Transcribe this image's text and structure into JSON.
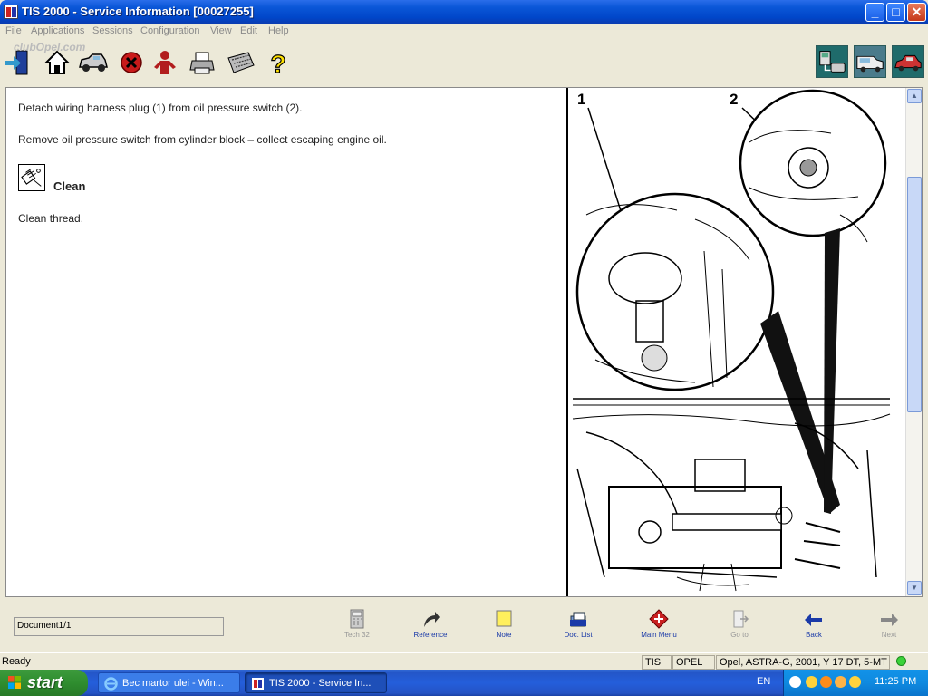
{
  "window": {
    "title": "TIS 2000 - Service Information [00027255]",
    "min_label": "_",
    "max_label": "□",
    "close_label": "✕"
  },
  "menu": {
    "items": [
      "File",
      "Applications",
      "Sessions",
      "Configuration",
      "View",
      "Edit",
      "Help"
    ]
  },
  "watermark": "clubOpel.com",
  "toolbar": {
    "icons": [
      "exit-icon",
      "home-icon",
      "vehicle-icon",
      "stop-icon",
      "user-icon",
      "print-icon",
      "keyboard-icon",
      "help-icon",
      "diagnostic-tool-icon",
      "van-icon",
      "car-icon"
    ]
  },
  "document": {
    "para1": "Detach wiring harness plug (1) from oil pressure switch (2).",
    "para2": "Remove oil pressure switch from cylinder block – collect escaping engine oil.",
    "clean_heading": "Clean",
    "para3": "Clean thread.",
    "figure_labels": [
      "1",
      "2"
    ]
  },
  "bottom": {
    "doc_indicator": "Document1/1",
    "buttons": [
      {
        "label": "Tech 32",
        "enabled": false
      },
      {
        "label": "Reference",
        "enabled": true
      },
      {
        "label": "Note",
        "enabled": true
      },
      {
        "label": "Doc. List",
        "enabled": true
      },
      {
        "label": "Main Menu",
        "enabled": true
      },
      {
        "label": "Go to",
        "enabled": false
      },
      {
        "label": "Back",
        "enabled": true
      },
      {
        "label": "Next",
        "enabled": false
      }
    ]
  },
  "status": {
    "text": "Ready",
    "app": "TIS",
    "brand": "OPEL",
    "vehicle": "Opel, ASTRA-G, 2001, Y 17 DT, 5-MT"
  },
  "taskbar": {
    "start_label": "start",
    "tasks": [
      {
        "label": "Bec martor ulei - Win..."
      },
      {
        "label": "TIS 2000 - Service In..."
      }
    ],
    "lang": "EN",
    "clock": "11:25 PM"
  },
  "colors": {
    "title_bar": "#0046c9",
    "taskbar": "#245edb",
    "start_button": "#2f8d2f",
    "link_label": "#1a3aa8"
  }
}
